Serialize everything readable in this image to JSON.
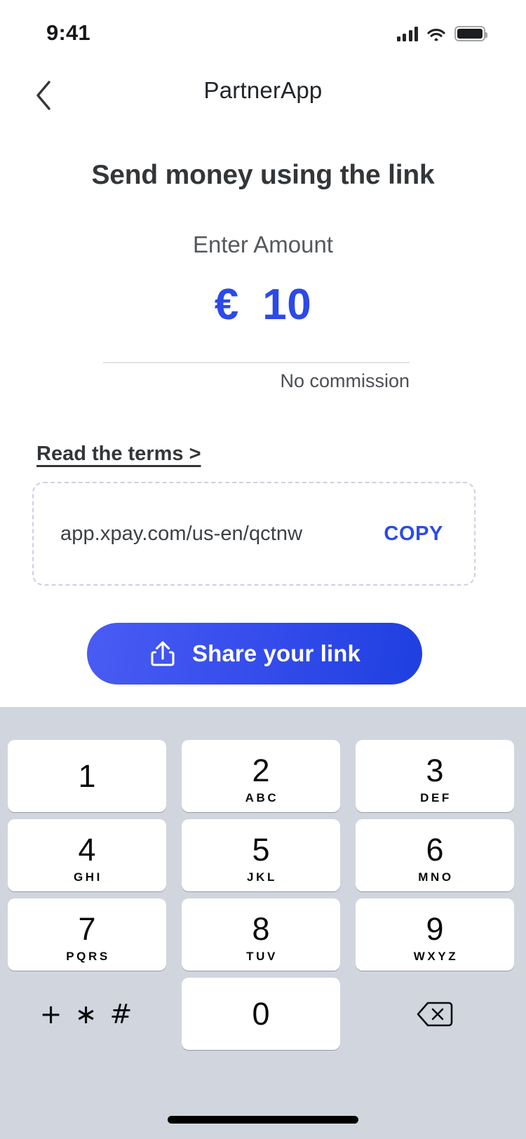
{
  "status_bar": {
    "time": "9:41",
    "icons": [
      "cellular-signal-icon",
      "wifi-icon",
      "battery-icon"
    ]
  },
  "nav": {
    "back_icon": "chevron-left-icon",
    "title": "PartnerApp"
  },
  "content": {
    "headline": "Send money using the link",
    "subtitle": "Enter Amount",
    "amount": {
      "currency_symbol": "€",
      "value": "10",
      "color": "#2c4ae8"
    },
    "commission_note": "No commission",
    "terms_link": "Read the terms >",
    "link_box": {
      "url": "app.xpay.com/us-en/qctnw",
      "copy_label": "COPY"
    },
    "share_button": {
      "label": "Share your link",
      "icon": "share-upload-icon",
      "gradient_from": "#4a5cf2",
      "gradient_to": "#1f3fe0"
    }
  },
  "keyboard": {
    "rows": [
      [
        {
          "digit": "1",
          "letters": ""
        },
        {
          "digit": "2",
          "letters": "ABC"
        },
        {
          "digit": "3",
          "letters": "DEF"
        }
      ],
      [
        {
          "digit": "4",
          "letters": "GHI"
        },
        {
          "digit": "5",
          "letters": "JKL"
        },
        {
          "digit": "6",
          "letters": "MNO"
        }
      ],
      [
        {
          "digit": "7",
          "letters": "PQRS"
        },
        {
          "digit": "8",
          "letters": "TUV"
        },
        {
          "digit": "9",
          "letters": "WXYZ"
        }
      ]
    ],
    "symbols_key": "+ ∗ #",
    "zero_key": {
      "digit": "0",
      "letters": ""
    },
    "delete_icon": "backspace-delete-icon",
    "background_color": "#d1d5de"
  }
}
